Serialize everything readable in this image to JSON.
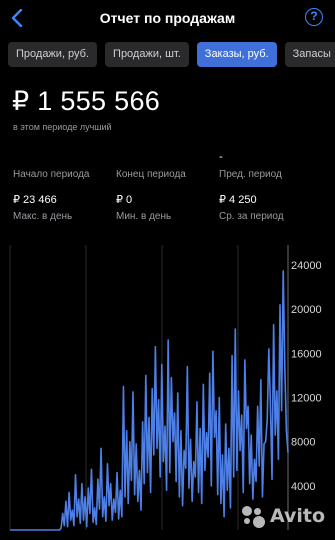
{
  "header": {
    "title": "Отчет по продажам",
    "back_icon": "chevron-left-icon",
    "help_label": "?"
  },
  "tabs": [
    {
      "label": "Продажи, руб.",
      "active": false
    },
    {
      "label": "Продажи, шт.",
      "active": false
    },
    {
      "label": "Заказы, руб.",
      "active": true
    },
    {
      "label": "Запасы",
      "active": false
    }
  ],
  "summary": {
    "total": "₽ 1 555 566",
    "note": "в этом периоде лучший"
  },
  "stats": {
    "period_start_label": "Начало периода",
    "period_end_label": "Конец периода",
    "prev_period_label": "Пред. период",
    "prev_period_value": "-",
    "max_value": "₽ 23 466",
    "max_label": "Макс. в день",
    "min_value": "₽ 0",
    "min_label": "Мин. в день",
    "avg_value": "₽ 4 250",
    "avg_label": "Ср. за период"
  },
  "watermark": "Avito",
  "colors": {
    "accent": "#3f6fd8",
    "line": "#4d7fe6",
    "background": "#000000"
  },
  "chart_data": {
    "type": "line",
    "y_ticks": [
      "24000",
      "20000",
      "16000",
      "12000",
      "8000",
      "4000"
    ],
    "ylim": [
      0,
      24000
    ],
    "grid": true,
    "series": [
      {
        "values": [
          0,
          0,
          0,
          0,
          0,
          0,
          0,
          0,
          0,
          0,
          0,
          0,
          0,
          0,
          0,
          0,
          0,
          0,
          0,
          0,
          0,
          0,
          0,
          0,
          0,
          0,
          0,
          0,
          0,
          0,
          0,
          0,
          200,
          1500,
          400,
          2600,
          300,
          3400,
          900,
          1800,
          400,
          5000,
          1200,
          2800,
          600,
          4200,
          900,
          3000,
          300,
          3800,
          1500,
          5500,
          700,
          2000,
          500,
          4600,
          1900,
          7400,
          1200,
          3000,
          800,
          6000,
          2200,
          4200,
          900,
          2800,
          1600,
          5200,
          1000,
          3600,
          1200,
          13000,
          3000,
          9000,
          2400,
          8000,
          4500,
          12500,
          3200,
          7800,
          2600,
          5400,
          1800,
          9800,
          4200,
          14000,
          5200,
          10200,
          3400,
          12800,
          6800,
          16600,
          7400,
          11800,
          4800,
          15000,
          6200,
          9400,
          3600,
          17200,
          5200,
          13800,
          8000,
          10600,
          4400,
          12400,
          3000,
          9000,
          2200,
          7200,
          5600,
          14800,
          3800,
          8200,
          2600,
          6200,
          4800,
          11600,
          3400,
          9200,
          2400,
          13200,
          5400,
          8800,
          6600,
          14200,
          4000,
          16200,
          8400,
          10800,
          3200,
          12000,
          2400,
          6800,
          1200,
          9600,
          3600,
          7400,
          2000,
          15800,
          4800,
          18200,
          5400,
          12600,
          7200,
          10400,
          3400,
          15400,
          9200,
          11200,
          4200,
          8600,
          2800,
          6400,
          4400,
          11200,
          5800,
          13600,
          3000,
          7800,
          8000,
          10000,
          16400,
          11400,
          4600,
          18600,
          8600,
          12600,
          6400,
          20400,
          10800,
          23466,
          14800,
          9000,
          7000
        ]
      }
    ]
  }
}
